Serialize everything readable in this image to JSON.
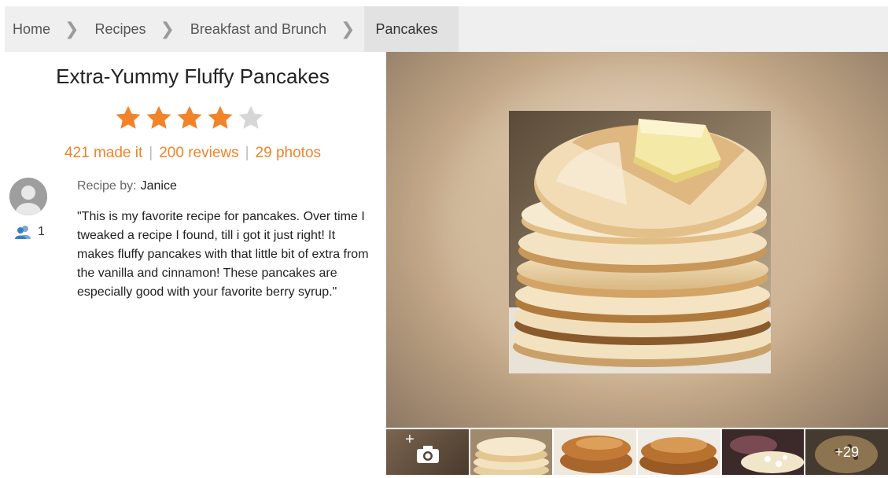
{
  "breadcrumb": {
    "items": [
      "Home",
      "Recipes",
      "Breakfast and Brunch"
    ],
    "current": "Pancakes"
  },
  "recipe": {
    "title": "Extra-Yummy Fluffy Pancakes",
    "rating": {
      "value": 4,
      "max": 5
    },
    "made_it": "421 made it",
    "reviews": "200 reviews",
    "photos": "29 photos",
    "byline_label": "Recipe by:",
    "author": "Janice",
    "followers": "1",
    "description": "\"This is my favorite recipe for pancakes. Over time I tweaked a recipe I found, till i got it just right! It makes fluffy pancakes with that little bit of extra from the vanilla and cinnamon! These pancakes are especially good with your favorite berry syrup.\""
  },
  "gallery": {
    "add_photo_plus": "+",
    "more_count": "+29"
  },
  "colors": {
    "accent": "#f28329",
    "star_empty": "#d6d6d6",
    "breadcrumb_bg": "#efefef",
    "breadcrumb_current_bg": "#e2e2e2",
    "follower_icon": "#3a7fc1"
  }
}
